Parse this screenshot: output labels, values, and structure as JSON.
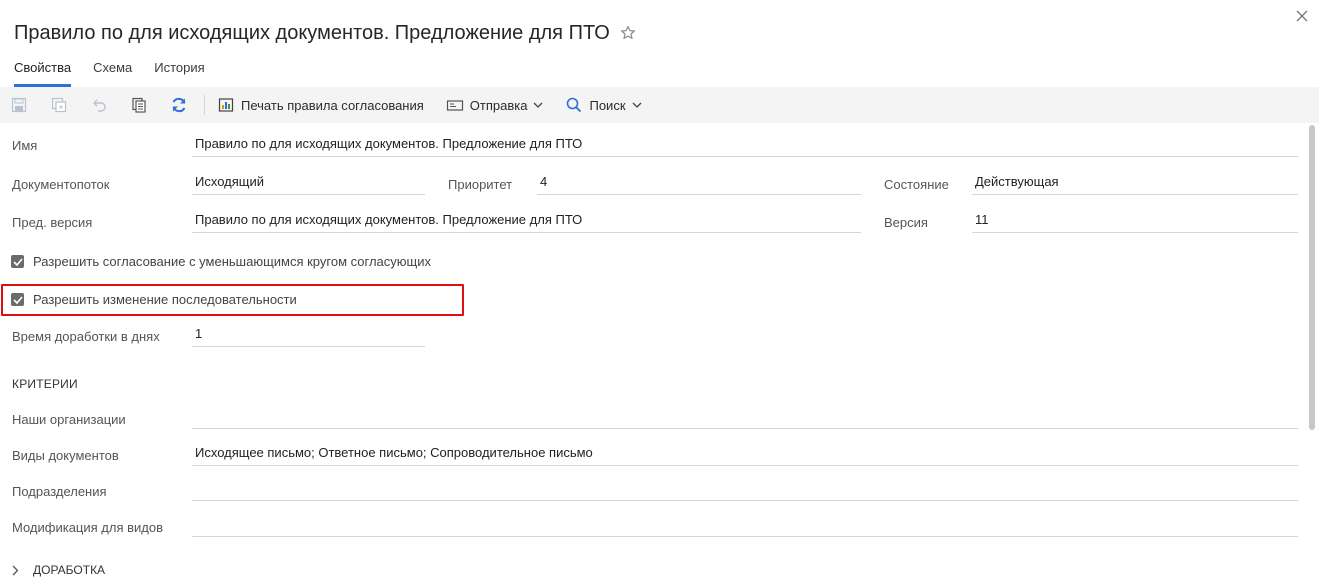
{
  "header": {
    "title": "Правило по для исходящих документов. Предложение для ПТО"
  },
  "tabs": [
    {
      "label": "Свойства",
      "active": true
    },
    {
      "label": "Схема",
      "active": false
    },
    {
      "label": "История",
      "active": false
    }
  ],
  "toolbar": {
    "print_label": "Печать правила согласования",
    "send_label": "Отправка",
    "search_label": "Поиск"
  },
  "form": {
    "name_label": "Имя",
    "name_value": "Правило по  для исходящих документов. Предложение для ПТО",
    "docflow_label": "Документопоток",
    "docflow_value": "Исходящий",
    "priority_label": "Приоритет",
    "priority_value": "4",
    "state_label": "Состояние",
    "state_value": "Действующая",
    "prev_version_label": "Пред. версия",
    "prev_version_value": "Правило по  для исходящих документов. Предложение для ПТО",
    "version_label": "Версия",
    "version_value": "11",
    "checkbox1_label": "Разрешить согласование с уменьшающимся кругом согласующих",
    "checkbox1_checked": true,
    "checkbox2_label": "Разрешить изменение последовательности",
    "checkbox2_checked": true,
    "rework_label": "Время доработки в днях",
    "rework_value": "1"
  },
  "criteria": {
    "section_title": "КРИТЕРИИ",
    "our_orgs_label": "Наши организации",
    "our_orgs_value": "",
    "doc_types_label": "Виды документов",
    "doc_types_value": "Исходящее письмо; Ответное письмо; Сопроводительное письмо",
    "departments_label": "Подразделения",
    "departments_value": "",
    "modification_label": "Модификация для видов",
    "modification_value": ""
  },
  "rework_section": {
    "title": "ДОРАБОТКА"
  },
  "colors": {
    "accent": "#2f6fd6",
    "highlight": "#e01010",
    "toolbar_bg": "#f4f4f4"
  }
}
